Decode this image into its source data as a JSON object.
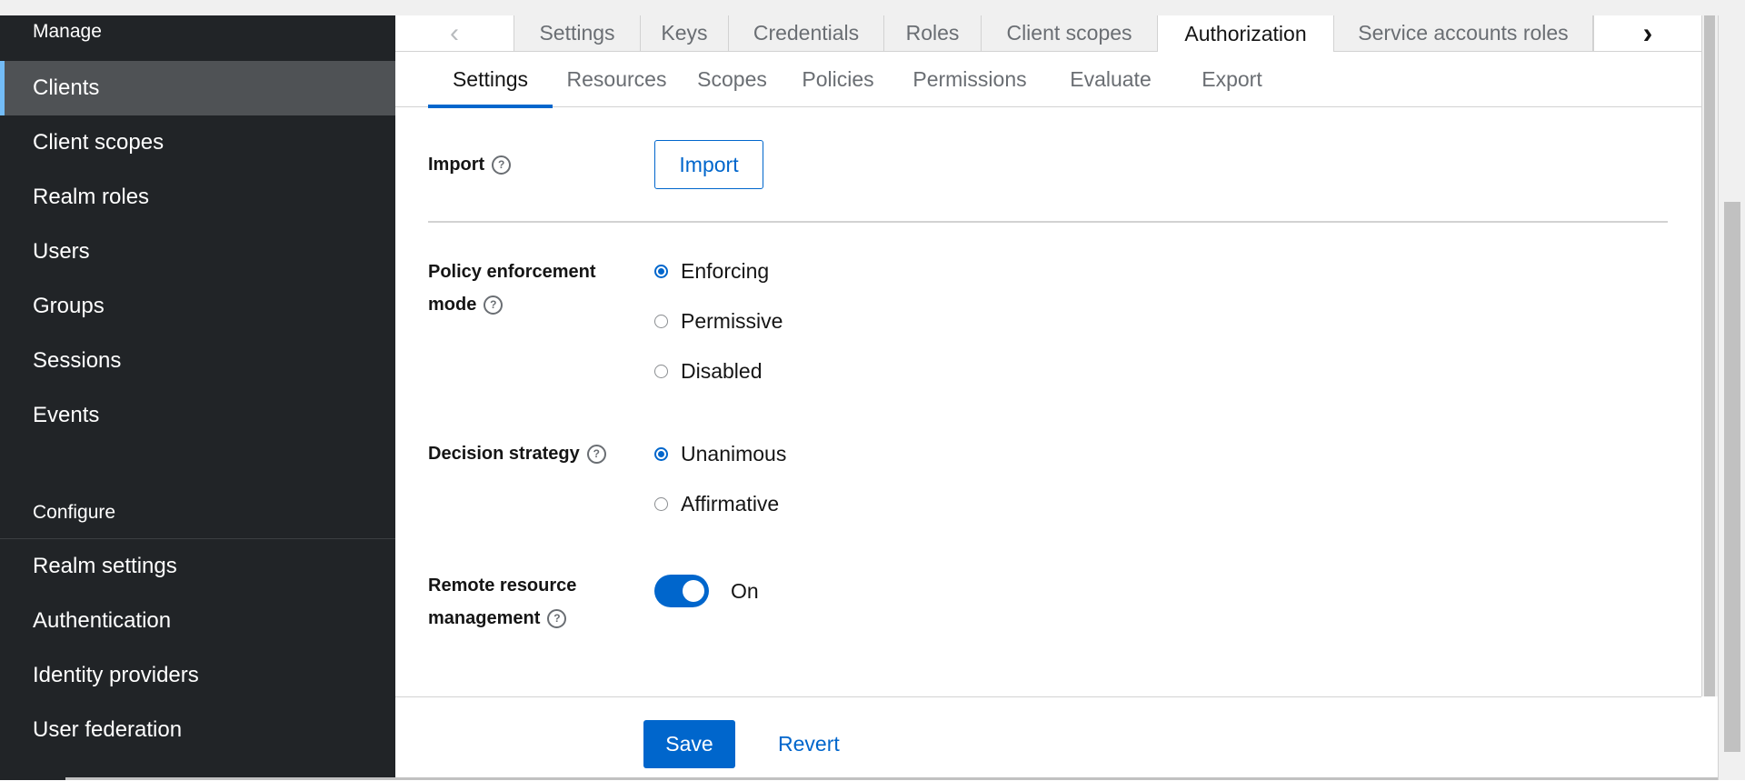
{
  "sidebar": {
    "manage_heading": "Manage",
    "manage_items": [
      "Clients",
      "Client scopes",
      "Realm roles",
      "Users",
      "Groups",
      "Sessions",
      "Events"
    ],
    "active_item": "Clients",
    "configure_heading": "Configure",
    "configure_items": [
      "Realm settings",
      "Authentication",
      "Identity providers",
      "User federation"
    ]
  },
  "tabs": {
    "prev_icon": "‹",
    "next_icon": "›",
    "items": [
      "Settings",
      "Keys",
      "Credentials",
      "Roles",
      "Client scopes",
      "Authorization",
      "Service accounts roles"
    ],
    "active": "Authorization"
  },
  "subtabs": {
    "items": [
      "Settings",
      "Resources",
      "Scopes",
      "Policies",
      "Permissions",
      "Evaluate",
      "Export"
    ],
    "active": "Settings"
  },
  "form": {
    "import": {
      "label": "Import",
      "button": "Import"
    },
    "policy_enforcement": {
      "label_line1": "Policy enforcement",
      "label_line2": "mode",
      "options": [
        "Enforcing",
        "Permissive",
        "Disabled"
      ],
      "selected": "Enforcing"
    },
    "decision_strategy": {
      "label": "Decision strategy",
      "options": [
        "Unanimous",
        "Affirmative"
      ],
      "selected": "Unanimous"
    },
    "remote_resource": {
      "label_line1": "Remote resource",
      "label_line2": "management",
      "toggle_state": "On"
    },
    "help_icon": "?"
  },
  "footer": {
    "save": "Save",
    "revert": "Revert"
  },
  "colors": {
    "accent": "#0066cc",
    "sidebar_bg": "#212427",
    "sidebar_active": "#4f5255",
    "active_marker": "#73bcf7"
  }
}
